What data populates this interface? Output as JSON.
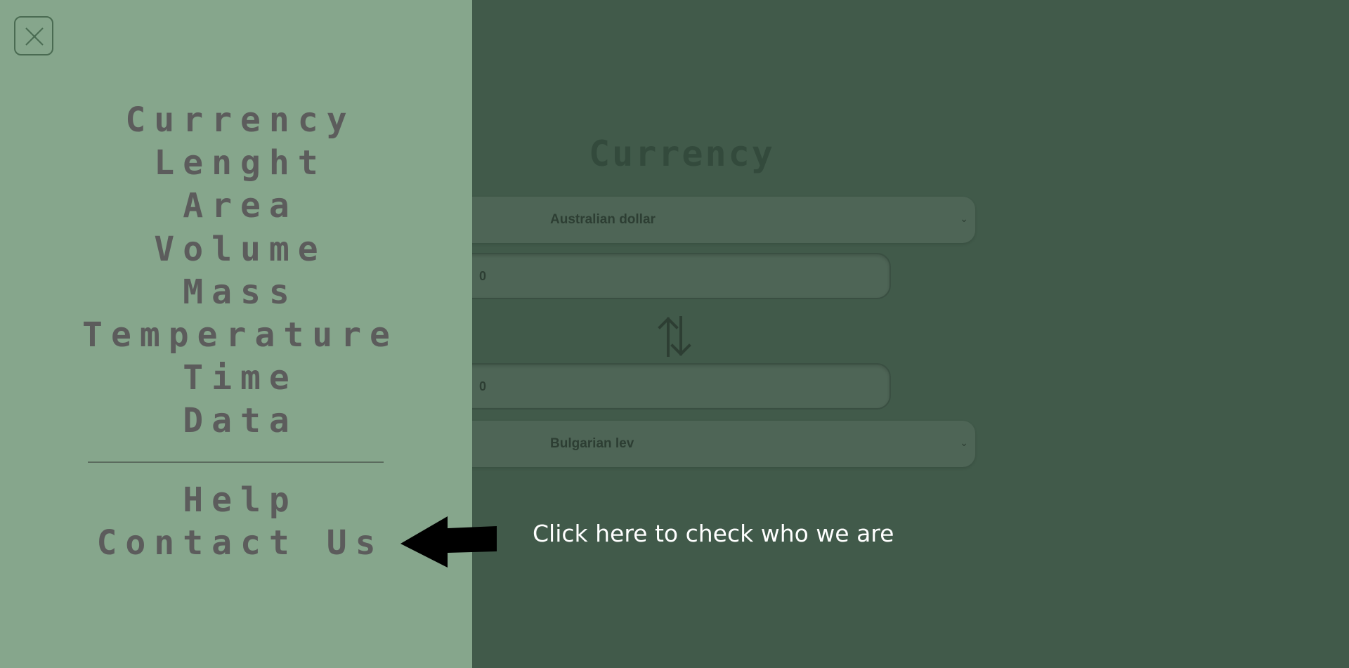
{
  "converter": {
    "title": "Currency",
    "from_currency": "Australian dollar",
    "from_value": "0",
    "to_value": "0",
    "to_currency": "Bulgarian lev"
  },
  "menu": {
    "items": [
      {
        "label": "Currency"
      },
      {
        "label": "Lenght"
      },
      {
        "label": "Area"
      },
      {
        "label": "Volume"
      },
      {
        "label": "Mass"
      },
      {
        "label": "Temperature"
      },
      {
        "label": "Time"
      },
      {
        "label": "Data"
      }
    ],
    "secondary": [
      {
        "label": "Help"
      },
      {
        "label": "Contact Us"
      }
    ]
  },
  "tooltip": {
    "text": "Click here to check who we are"
  },
  "icons": {
    "close": "close-icon",
    "swap": "swap-arrows-icon",
    "pointer": "arrow-left-icon",
    "dropdown": "chevron-down-icon"
  },
  "colors": {
    "background": "#415a4a",
    "sidebar": "#86a68c",
    "menu_text": "#5c5c5c",
    "hint_text": "#ffffff"
  }
}
